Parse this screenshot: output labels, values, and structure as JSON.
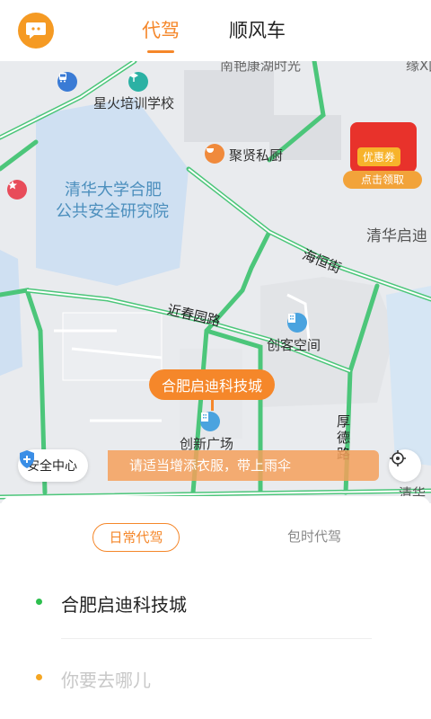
{
  "header": {
    "tabs": [
      {
        "label": "代驾",
        "active": true
      },
      {
        "label": "顺风车",
        "active": false
      }
    ],
    "accent_color": "#f5872a"
  },
  "map": {
    "labels": {
      "top_cut": "南艳康湖时光",
      "top_right_cut": "缘X国际",
      "school": "星火培训学校",
      "restaurant": "聚贤私厨",
      "institute_line1": "清华大学合肥",
      "institute_line2": "公共安全研究院",
      "right_area": "清华启迪",
      "road_haiheng": "海恒街",
      "road_jinchun": "近春园路",
      "cowork": "创客空间",
      "plaza": "创新广场",
      "road_houde": "厚德路",
      "bottom_right_cut": "清华"
    },
    "pin_label": "合肥启迪科技城",
    "coupon": {
      "tag": "优惠券",
      "claim": "点击领取"
    },
    "safety_center": "安全中心",
    "notice": "请适当增添衣服，带上雨伞"
  },
  "panel": {
    "mode_tabs": [
      {
        "label": "日常代驾",
        "active": true
      },
      {
        "label": "包时代驾",
        "active": false
      }
    ],
    "origin": "合肥启迪科技城",
    "destination_placeholder": "你要去哪儿",
    "origin_dot_color": "#2dbf4e",
    "destination_dot_color": "#f5a623"
  }
}
